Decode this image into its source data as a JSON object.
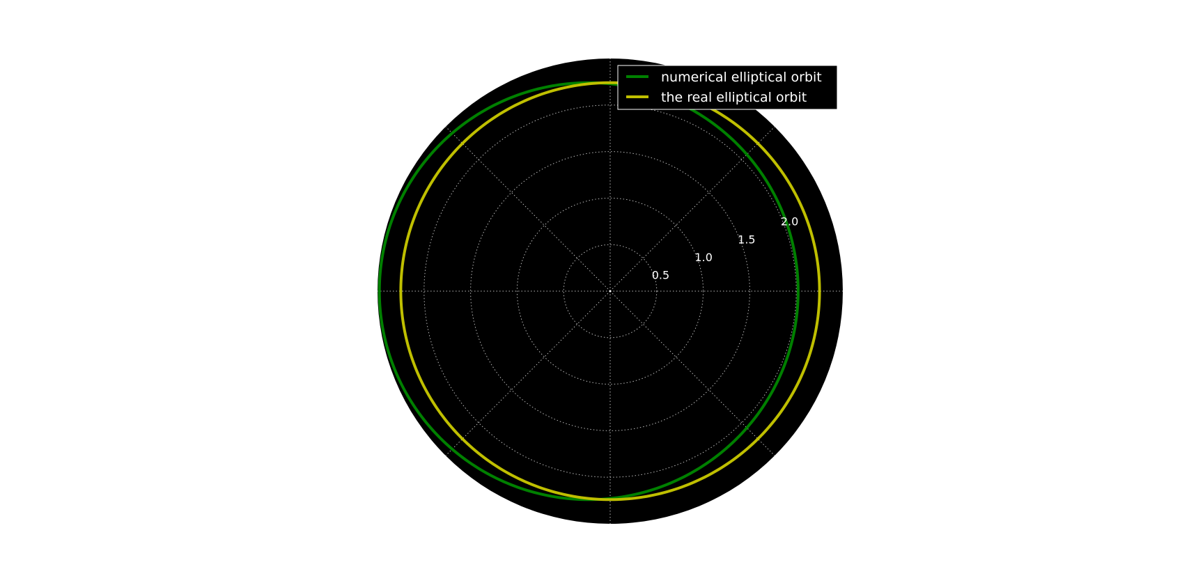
{
  "chart_data": {
    "type": "line",
    "projection": "polar",
    "title": "",
    "rmax": 2.5,
    "r_ticks": [
      0.5,
      1.0,
      1.5,
      2.0
    ],
    "r_tick_labels": [
      "0.5",
      "1.0",
      "1.5",
      "2.0"
    ],
    "theta_gridlines_deg": [
      0,
      45,
      90,
      135,
      180,
      225,
      270,
      315
    ],
    "grid": true,
    "legend_position": "top-right",
    "colors": {
      "axes_background": "#000000",
      "figure_background": "#ffffff",
      "grid": "#bbbbbb",
      "tick_label": "#ffffff"
    },
    "series": [
      {
        "name": "numerical elliptical orbit",
        "color": "#008000",
        "ellipse": {
          "a": 2.25,
          "b": 2.24,
          "center_x": -0.23,
          "center_y": 0.0
        }
      },
      {
        "name": "the real elliptical orbit",
        "color": "#bfbf00",
        "ellipse": {
          "a": 2.25,
          "b": 2.24,
          "center_x": 0.0,
          "center_y": 0.0
        }
      }
    ]
  }
}
